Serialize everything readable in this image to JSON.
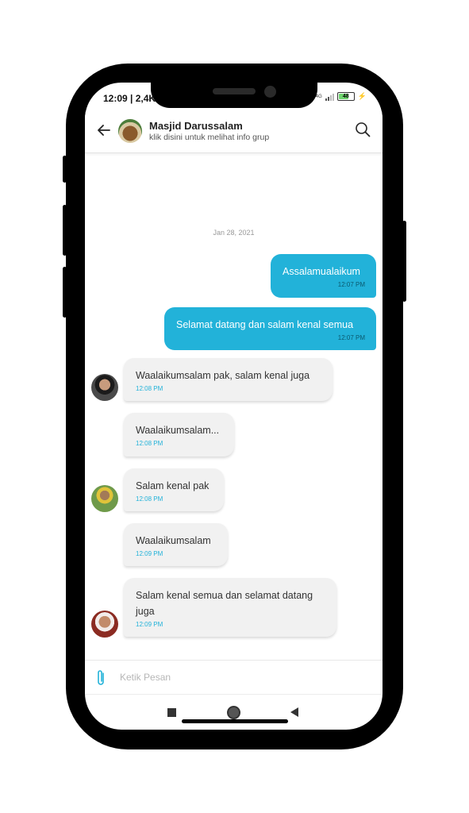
{
  "status_bar": {
    "time": "12:09 | 2,4K",
    "network": "4G",
    "battery": "48"
  },
  "header": {
    "title": "Masjid Darussalam",
    "subtitle": "klik disini untuk melihat info grup",
    "icons": {
      "back": "arrow-left-icon",
      "search": "search-icon"
    }
  },
  "chat": {
    "date_separator": "Jan 28, 2021",
    "messages": [
      {
        "direction": "outgoing",
        "text": "Assalamualaikum",
        "time": "12:07 PM"
      },
      {
        "direction": "outgoing",
        "text": "Selamat datang dan salam kenal semua",
        "time": "12:07 PM"
      },
      {
        "direction": "incoming",
        "text": "Waalaikumsalam pak, salam kenal juga",
        "time": "12:08 PM"
      },
      {
        "direction": "incoming",
        "text": "Waalaikumsalam...",
        "time": "12:08 PM"
      },
      {
        "direction": "incoming",
        "text": "Salam kenal pak",
        "time": "12:08 PM"
      },
      {
        "direction": "incoming",
        "text": "Waalaikumsalam",
        "time": "12:09 PM"
      },
      {
        "direction": "incoming",
        "text": "Salam kenal semua dan selamat datang juga",
        "time": "12:09 PM"
      }
    ]
  },
  "composer": {
    "placeholder": "Ketik Pesan",
    "value": "",
    "icon": "paperclip-icon"
  },
  "nav": {
    "icons": [
      "recents-icon",
      "home-icon",
      "back-icon"
    ]
  },
  "colors": {
    "accent": "#22b2d9",
    "incoming_bubble": "#f1f1f1"
  }
}
